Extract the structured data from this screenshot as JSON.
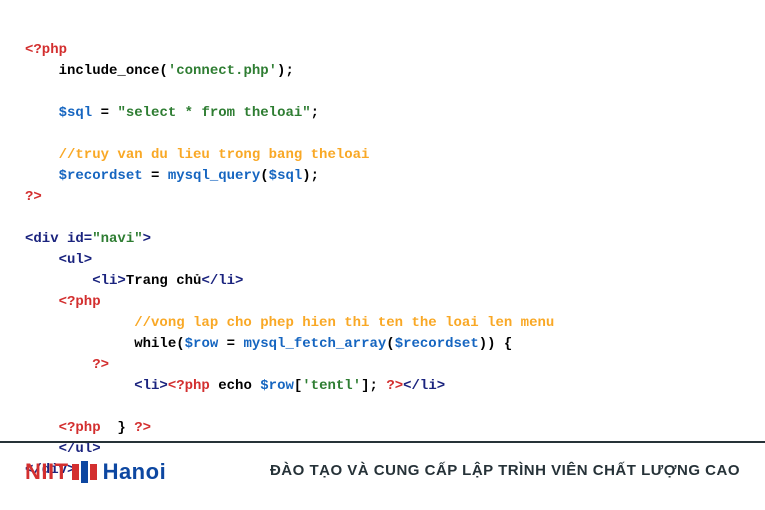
{
  "code": {
    "l1a": "<?php",
    "l2a": "    include_once(",
    "l2b": "'connect.php'",
    "l2c": ");",
    "l4a": "    $sql",
    "l4b": " = ",
    "l4c": "\"select * from theloai\"",
    "l4d": ";",
    "l6a": "    //truy van du lieu trong bang theloai",
    "l7a": "    $recordset",
    "l7b": " = ",
    "l7c": "mysql_query",
    "l7d": "(",
    "l7e": "$sql",
    "l7f": ");",
    "l8a": "?>",
    "l10a": "<div id=",
    "l10b": "\"navi\"",
    "l10c": ">",
    "l11a": "    <ul>",
    "l12a": "        <li>",
    "l12b": "Trang chủ",
    "l12c": "</li>",
    "l13a": "    <?php",
    "l14a": "             //vong lap cho phep hien thi ten the loai len menu",
    "l15a": "             while(",
    "l15b": "$row",
    "l15c": " = ",
    "l15d": "mysql_fetch_array",
    "l15e": "(",
    "l15f": "$recordset",
    "l15g": ")) {",
    "l16a": "        ?>",
    "l17a": "             <li>",
    "l17b": "<?php",
    "l17c": " echo ",
    "l17d": "$row",
    "l17e": "[",
    "l17f": "'tentl'",
    "l17g": "]; ",
    "l17h": "?>",
    "l17i": "</li>",
    "l19a": "    <?php",
    "l19b": "  } ",
    "l19c": "?>",
    "l20a": "    </ul>",
    "l21a": "</div>"
  },
  "footer": {
    "logo_niit": "NIIT",
    "logo_hanoi": "Hanoi",
    "tagline": "ĐÀO TẠO VÀ CUNG CẤP LẬP TRÌNH VIÊN CHẤT LƯỢNG CAO"
  }
}
